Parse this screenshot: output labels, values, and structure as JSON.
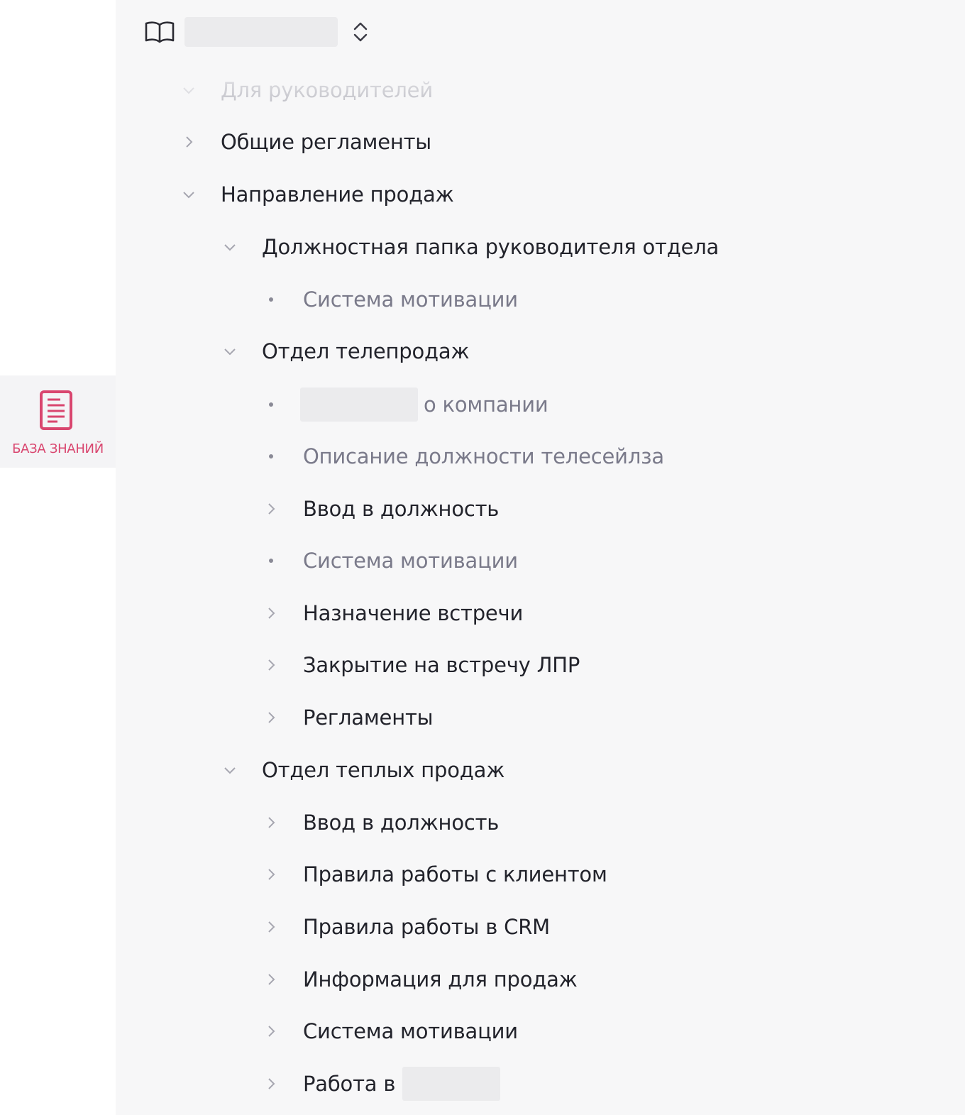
{
  "rail": {
    "item_label": "БАЗА ЗНАНИЙ",
    "accent_color": "#d9466f",
    "icon": "document-icon"
  },
  "header": {
    "icon": "book-icon",
    "switcher_value": "",
    "switcher_icon": "chevron-updown-icon"
  },
  "tree": {
    "partial_top": "Для руководителей",
    "items": [
      {
        "label": "Общие регламенты",
        "state": "collapsed"
      },
      {
        "label": "Направление продаж",
        "state": "expanded"
      },
      {
        "label": "Должностная папка руководителя отдела",
        "state": "expanded"
      },
      {
        "label": "Система мотивации",
        "state": "leaf"
      },
      {
        "label": "Отдел телепродаж",
        "state": "expanded"
      },
      {
        "label": "о компании",
        "state": "leaf",
        "redacted_prefix": true
      },
      {
        "label": "Описание должности телесейлза",
        "state": "leaf"
      },
      {
        "label": "Ввод в должность",
        "state": "collapsed"
      },
      {
        "label": "Система мотивации",
        "state": "leaf"
      },
      {
        "label": "Назначение встречи",
        "state": "collapsed"
      },
      {
        "label": "Закрытие на встречу ЛПР",
        "state": "collapsed"
      },
      {
        "label": "Регламенты",
        "state": "collapsed"
      },
      {
        "label": "Отдел теплых продаж",
        "state": "expanded"
      },
      {
        "label": "Ввод в должность",
        "state": "collapsed"
      },
      {
        "label": "Правила работы с клиентом",
        "state": "collapsed"
      },
      {
        "label": "Правила работы в CRM",
        "state": "collapsed"
      },
      {
        "label": "Информация для продаж",
        "state": "collapsed"
      },
      {
        "label": "Система мотивации",
        "state": "collapsed"
      },
      {
        "label": "Работа в",
        "state": "collapsed",
        "redacted_suffix": true
      }
    ]
  }
}
